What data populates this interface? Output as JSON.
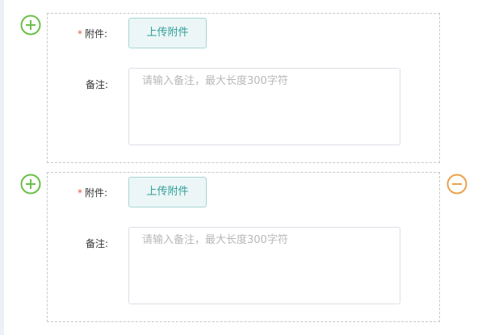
{
  "attachments_form": {
    "groups": [
      {
        "attachment_label": "附件:",
        "required_mark": "*",
        "upload_button_label": "上传附件",
        "note_label": "备注:",
        "note_value": "",
        "note_placeholder": "请输入备注，最大长度300字符",
        "has_remove_button": false
      },
      {
        "attachment_label": "附件:",
        "required_mark": "*",
        "upload_button_label": "上传附件",
        "note_label": "备注:",
        "note_value": "",
        "note_placeholder": "请输入备注，最大长度300字符",
        "has_remove_button": true
      }
    ]
  },
  "icons": {
    "add": "plus-circle-icon",
    "remove": "minus-circle-icon"
  },
  "colors": {
    "add_icon": "#6cc04a",
    "remove_icon": "#e8a34d",
    "upload_button_text": "#2f9e9a",
    "upload_button_bg": "#ecf6f6",
    "required_mark": "#e05b4b",
    "placeholder_text": "#b8b8b8"
  }
}
